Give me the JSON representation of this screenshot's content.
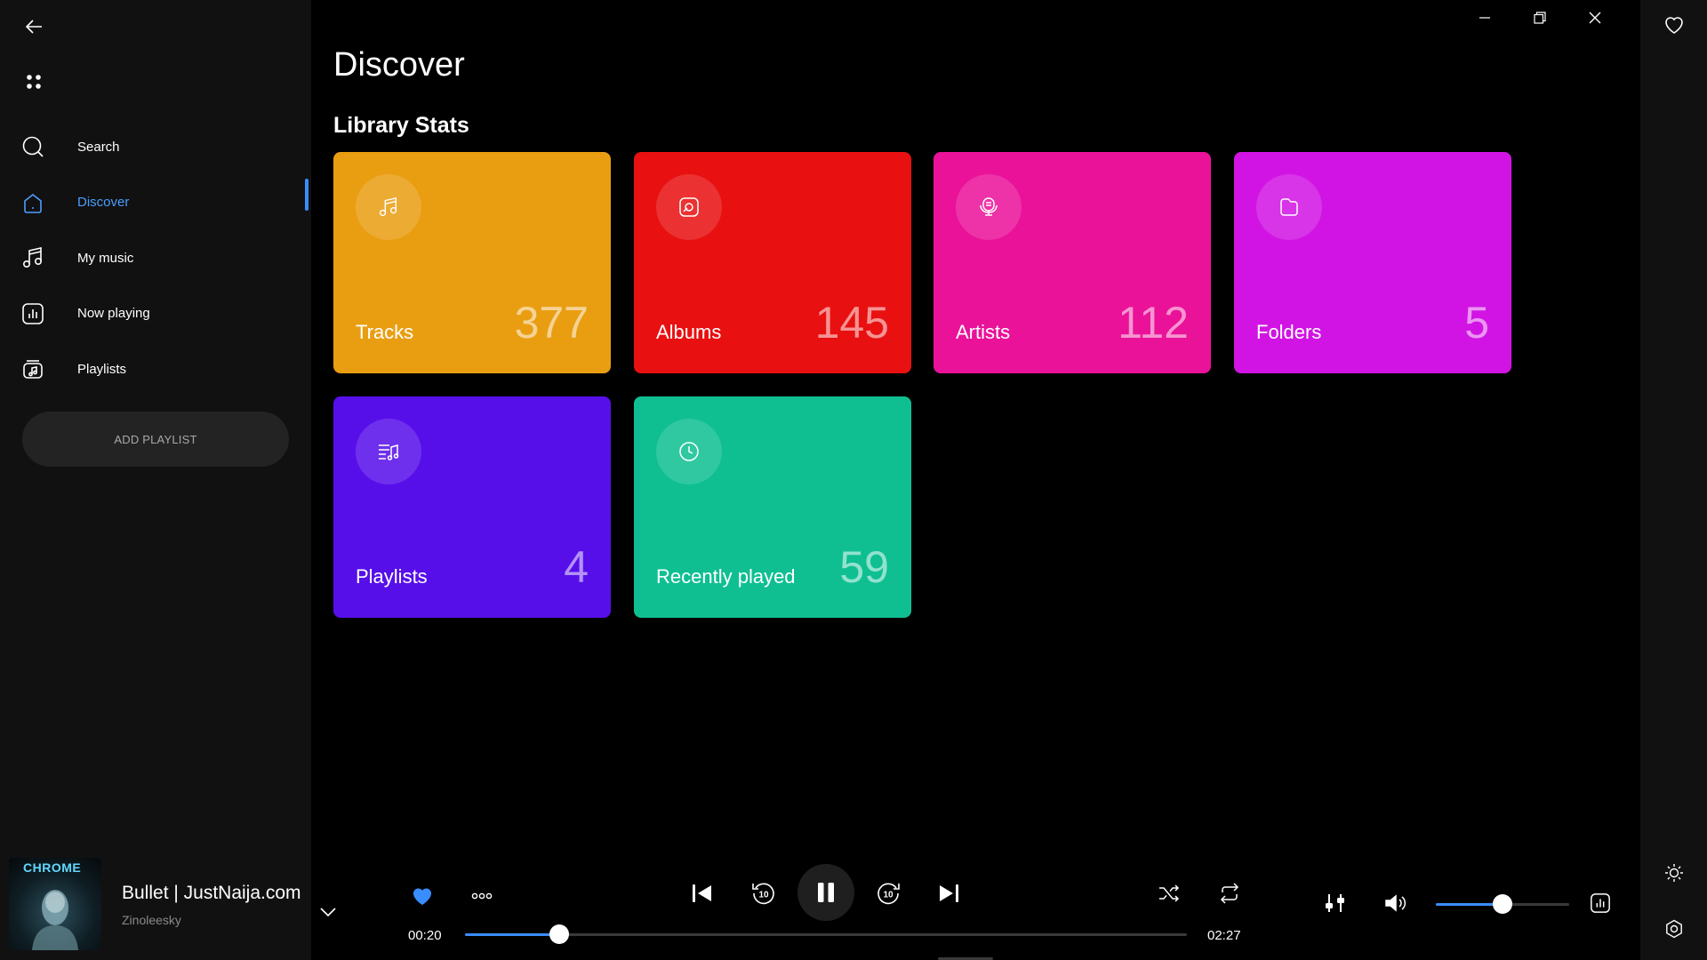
{
  "sidebar": {
    "items": [
      {
        "label": "Search",
        "icon": "search-icon"
      },
      {
        "label": "Discover",
        "icon": "home-icon",
        "active": true
      },
      {
        "label": "My music",
        "icon": "music-note-icon"
      },
      {
        "label": "Now playing",
        "icon": "equalizer-icon"
      },
      {
        "label": "Playlists",
        "icon": "playlist-icon"
      }
    ],
    "add_playlist_label": "ADD PLAYLIST"
  },
  "main": {
    "title": "Discover",
    "section_title": "Library Stats",
    "tiles": [
      {
        "label": "Tracks",
        "count": "377",
        "color": "#E99E12",
        "icon": "music-note-icon"
      },
      {
        "label": "Albums",
        "count": "145",
        "color": "#E81010",
        "icon": "album-icon"
      },
      {
        "label": "Artists",
        "count": "112",
        "color": "#EA1299",
        "icon": "artist-icon"
      },
      {
        "label": "Folders",
        "count": "5",
        "color": "#D114E4",
        "icon": "folder-icon"
      },
      {
        "label": "Playlists",
        "count": "4",
        "color": "#570FEA",
        "icon": "playlist-icon"
      },
      {
        "label": "Recently played",
        "count": "59",
        "color": "#0FBF92",
        "icon": "clock-icon"
      }
    ]
  },
  "player": {
    "album_art_text": "CHROME",
    "track_title": "Bullet | JustNaija.com",
    "track_artist": "Zinoleesky",
    "current_time": "00:20",
    "total_time": "02:27",
    "progress_fraction": 0.13,
    "volume_fraction": 0.5,
    "liked": true
  },
  "colors": {
    "accent": "#3A8DFF",
    "sidebar_bg": "#111111",
    "main_bg": "#000000"
  }
}
